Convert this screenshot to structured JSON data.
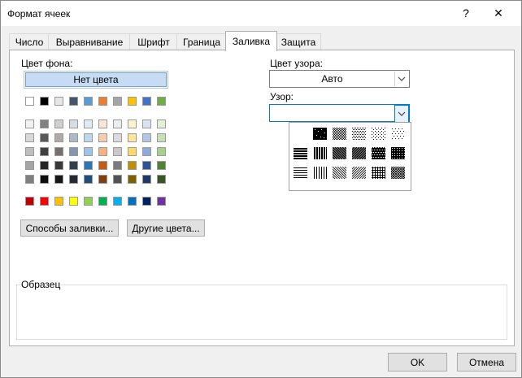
{
  "window": {
    "title": "Формат ячеек",
    "help": "?",
    "close": "✕"
  },
  "tabs": [
    "Число",
    "Выравнивание",
    "Шрифт",
    "Граница",
    "Заливка",
    "Защита"
  ],
  "fill": {
    "bg_label": "Цвет фона:",
    "no_color": "Нет цвета",
    "theme_row": [
      "#ffffff",
      "#000000",
      "#e7e6e6",
      "#44546a",
      "#5b9bd5",
      "#ed7d31",
      "#a5a5a5",
      "#ffc000",
      "#4472c4",
      "#70ad47"
    ],
    "tints": [
      [
        "#f2f2f2",
        "#808080",
        "#d0cece",
        "#d6dce4",
        "#deebf6",
        "#fbe5d5",
        "#ededed",
        "#fff2cc",
        "#d9e2f3",
        "#e2efd9"
      ],
      [
        "#d8d8d8",
        "#595959",
        "#aeaaaa",
        "#adb9ca",
        "#bdd7ee",
        "#f7cbac",
        "#dbdbdb",
        "#fee599",
        "#b4c6e7",
        "#c5e0b3"
      ],
      [
        "#bfbfbf",
        "#404040",
        "#757070",
        "#8496b0",
        "#9dc3e6",
        "#f4b183",
        "#c9c9c9",
        "#ffd966",
        "#8eaadb",
        "#a8d08d"
      ],
      [
        "#a5a5a5",
        "#262626",
        "#3a3838",
        "#323f4f",
        "#2e75b5",
        "#c55a11",
        "#7b7b7b",
        "#bf9000",
        "#2f5496",
        "#538135"
      ],
      [
        "#7f7f7f",
        "#0d0d0d",
        "#171616",
        "#222a35",
        "#1f4e79",
        "#833c0b",
        "#525252",
        "#7f6000",
        "#1f3864",
        "#375623"
      ]
    ],
    "standard_row": [
      "#c00000",
      "#ff0000",
      "#ffc000",
      "#ffff00",
      "#92d050",
      "#00b050",
      "#00b0f0",
      "#0070c0",
      "#002060",
      "#7030a0"
    ],
    "fill_effects": "Способы заливки...",
    "more_colors": "Другие цвета...",
    "pattern_color_label": "Цвет узора:",
    "pattern_color_value": "Авто",
    "pattern_label": "Узор:",
    "pattern_value": ""
  },
  "patterns": [
    [
      "none",
      "dense",
      "checker-med",
      "dots-med",
      "dots-light",
      "dots-faint"
    ],
    [
      "h-bold",
      "v-bold",
      "diag-down-bold",
      "diag-up-bold",
      "grid-bold",
      "trellis"
    ],
    [
      "h-thin",
      "v-thin",
      "diag-down-thin",
      "diag-up-thin",
      "grid-thin",
      "cross-thin"
    ]
  ],
  "sample": {
    "label": "Образец"
  },
  "footer": {
    "ok": "OK",
    "cancel": "Отмена"
  }
}
